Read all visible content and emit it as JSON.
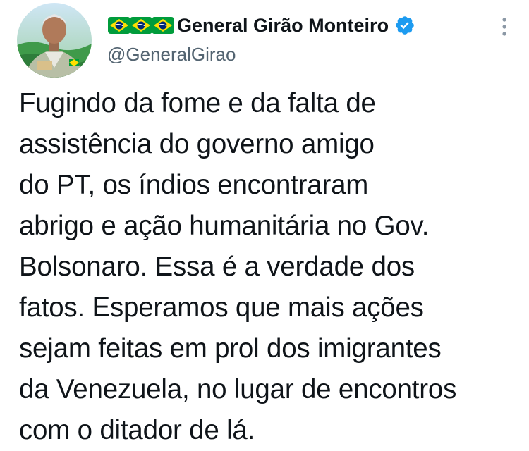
{
  "author": {
    "display_name": "General Girão Monteiro",
    "handle": "@GeneralGirao",
    "name_prefix_icons": [
      "brazil-flag-icon",
      "brazil-flag-icon",
      "brazil-flag-icon"
    ],
    "verified": true
  },
  "tweet": {
    "lines": [
      "Fugindo da fome e da falta de",
      "assistência do governo amigo",
      "do PT, os índios encontraram",
      "abrigo e ação humanitária no Gov.",
      "Bolsonaro. Essa é a verdade dos",
      "fatos. Esperamos que mais ações",
      "sejam feitas em prol dos imigrantes",
      "da Venezuela, no lugar de encontros",
      "com o ditador de lá."
    ]
  },
  "colors": {
    "text": "#0f1419",
    "secondary": "#536471",
    "verified": "#1d9bf0",
    "flag_green": "#009c3b",
    "flag_yellow": "#ffdf00",
    "flag_blue": "#002776"
  }
}
